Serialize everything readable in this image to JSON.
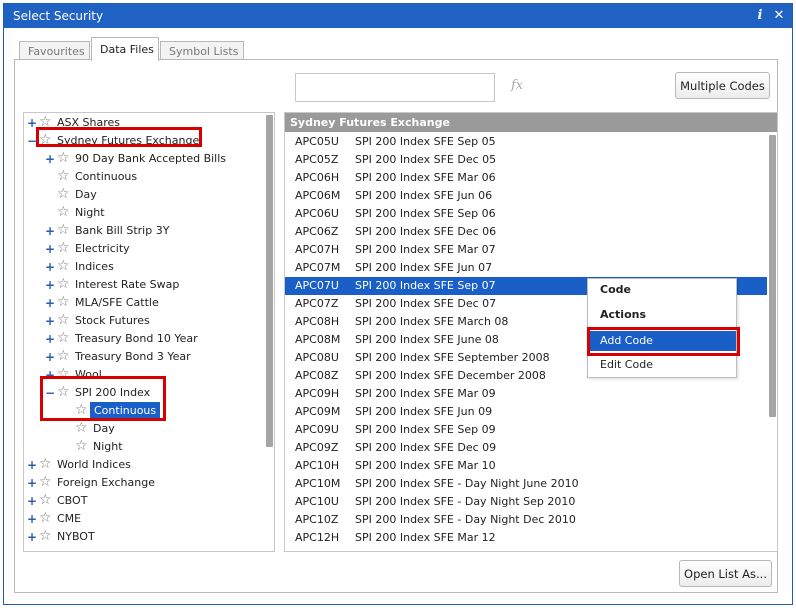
{
  "window": {
    "title": "Select Security"
  },
  "tabs": [
    {
      "label": "Favourites",
      "active": false
    },
    {
      "label": "Data Files",
      "active": true
    },
    {
      "label": "Symbol Lists",
      "active": false
    }
  ],
  "toolbar": {
    "code_input_value": "",
    "fx_symbol": "fx",
    "multiple_codes_label": "Multiple Codes"
  },
  "tree": {
    "items": [
      {
        "label": "ASX Shares",
        "toggle": "+"
      },
      {
        "label": "Sydney Futures Exchange",
        "toggle": "−"
      },
      {
        "label": "90 Day Bank Accepted Bills",
        "toggle": "+"
      },
      {
        "label": "Continuous",
        "toggle": ""
      },
      {
        "label": "Day",
        "toggle": ""
      },
      {
        "label": "Night",
        "toggle": ""
      },
      {
        "label": "Bank Bill Strip 3Y",
        "toggle": "+"
      },
      {
        "label": "Electricity",
        "toggle": "+"
      },
      {
        "label": "Indices",
        "toggle": "+"
      },
      {
        "label": "Interest Rate Swap",
        "toggle": "+"
      },
      {
        "label": "MLA/SFE Cattle",
        "toggle": "+"
      },
      {
        "label": "Stock Futures",
        "toggle": "+"
      },
      {
        "label": "Treasury Bond 10 Year",
        "toggle": "+"
      },
      {
        "label": "Treasury Bond 3 Year",
        "toggle": "+"
      },
      {
        "label": "Wool",
        "toggle": "+"
      },
      {
        "label": "SPI 200 Index",
        "toggle": "−"
      },
      {
        "label": "Continuous",
        "toggle": ""
      },
      {
        "label": "Day",
        "toggle": ""
      },
      {
        "label": "Night",
        "toggle": ""
      },
      {
        "label": "World Indices",
        "toggle": "+"
      },
      {
        "label": "Foreign Exchange",
        "toggle": "+"
      },
      {
        "label": "CBOT",
        "toggle": "+"
      },
      {
        "label": "CME",
        "toggle": "+"
      },
      {
        "label": "NYBOT",
        "toggle": "+"
      }
    ]
  },
  "list": {
    "header": "Sydney Futures Exchange",
    "rows": [
      {
        "code": "APC05U",
        "desc": "SPI 200 Index SFE Sep 05"
      },
      {
        "code": "APC05Z",
        "desc": "SPI 200 Index SFE Dec 05"
      },
      {
        "code": "APC06H",
        "desc": "SPI 200 Index SFE Mar 06"
      },
      {
        "code": "APC06M",
        "desc": "SPI 200 Index SFE Jun 06"
      },
      {
        "code": "APC06U",
        "desc": "SPI 200 Index SFE Sep 06"
      },
      {
        "code": "APC06Z",
        "desc": "SPI 200 Index SFE Dec 06"
      },
      {
        "code": "APC07H",
        "desc": "SPI 200 Index SFE Mar 07"
      },
      {
        "code": "APC07M",
        "desc": "SPI 200 Index SFE Jun 07"
      },
      {
        "code": "APC07U",
        "desc": "SPI 200 Index SFE Sep 07"
      },
      {
        "code": "APC07Z",
        "desc": "SPI 200 Index SFE Dec 07"
      },
      {
        "code": "APC08H",
        "desc": "SPI 200 Index SFE March 08"
      },
      {
        "code": "APC08M",
        "desc": "SPI 200 Index SFE June 08"
      },
      {
        "code": "APC08U",
        "desc": "SPI 200 Index SFE September 2008"
      },
      {
        "code": "APC08Z",
        "desc": "SPI 200 Index SFE December 2008"
      },
      {
        "code": "APC09H",
        "desc": "SPI 200 Index SFE Mar 09"
      },
      {
        "code": "APC09M",
        "desc": "SPI 200 Index SFE Jun 09"
      },
      {
        "code": "APC09U",
        "desc": "SPI 200 Index SFE Sep 09"
      },
      {
        "code": "APC09Z",
        "desc": "SPI 200 Index SFE Dec 09"
      },
      {
        "code": "APC10H",
        "desc": "SPI 200 Index SFE Mar 10"
      },
      {
        "code": "APC10M",
        "desc": "SPI 200 Index SFE - Day Night June 2010"
      },
      {
        "code": "APC10U",
        "desc": "SPI 200 Index SFE - Day Night Sep 2010"
      },
      {
        "code": "APC10Z",
        "desc": "SPI 200 Index SFE - Day Night Dec 2010"
      },
      {
        "code": "APC12H",
        "desc": "SPI 200 Index SFE Mar 12"
      }
    ]
  },
  "context_menu": {
    "header_code": "Code",
    "header_actions": "Actions",
    "add_code": "Add Code",
    "edit_code": "Edit Code"
  },
  "footer": {
    "open_list_label": "Open List As..."
  },
  "colors": {
    "titlebar": "#1f62c4",
    "selection": "#1a5fc8",
    "highlight": "#d60000"
  }
}
